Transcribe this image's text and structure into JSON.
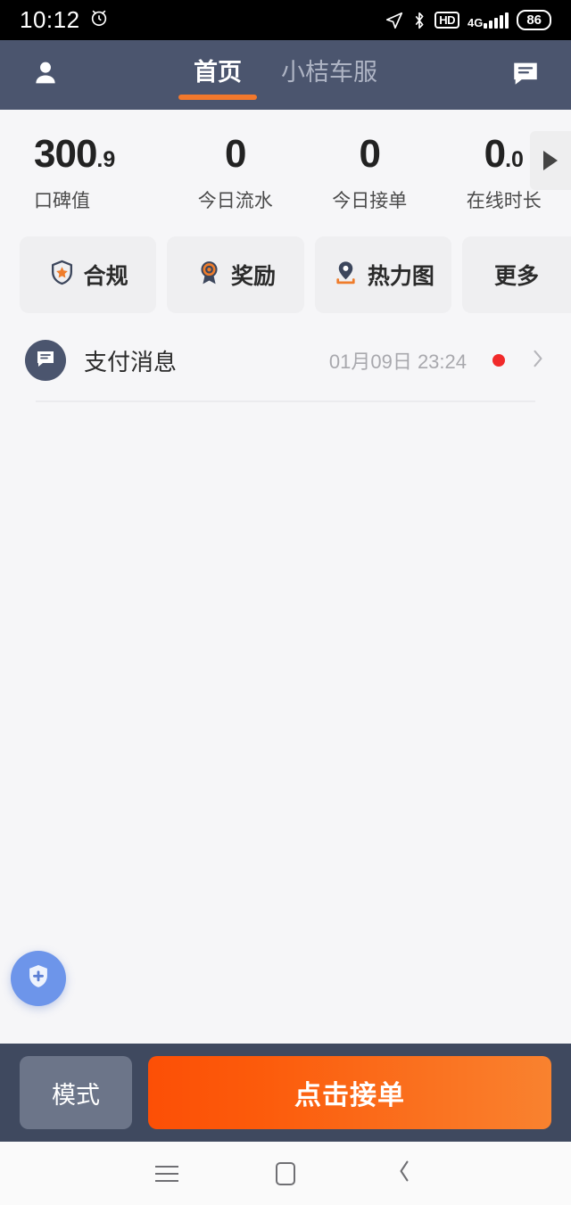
{
  "status_bar": {
    "time": "10:12",
    "alarm_icon": "alarm-icon",
    "location_icon": "location-arrow-icon",
    "bluetooth_icon": "bluetooth-icon",
    "hd_label": "HD",
    "network_label": "4G",
    "battery_level": "86"
  },
  "header": {
    "profile_icon": "person-icon",
    "message_icon": "chat-bubble-icon",
    "tabs": [
      {
        "label": "首页",
        "active": true
      },
      {
        "label": "小桔车服",
        "active": false
      }
    ],
    "background_color": "#4b556e",
    "active_underline_color": "#f2782c"
  },
  "stats": {
    "items": [
      {
        "integer": "300",
        "decimal": ".9",
        "label": "口碑值"
      },
      {
        "integer": "0",
        "decimal": "",
        "label": "今日流水"
      },
      {
        "integer": "0",
        "decimal": "",
        "label": "今日接单"
      },
      {
        "integer": "0",
        "decimal": ".0",
        "label": "在线时长"
      }
    ],
    "expand_icon": "play-triangle-right-icon"
  },
  "quick_actions": [
    {
      "label": "合规",
      "icon": "shield-star-icon"
    },
    {
      "label": "奖励",
      "icon": "medal-icon"
    },
    {
      "label": "热力图",
      "icon": "map-pin-icon"
    },
    {
      "label": "更多",
      "icon": ""
    }
  ],
  "message": {
    "avatar_icon": "chat-bubble-icon",
    "title": "支付消息",
    "timestamp": "01月09日 23:24",
    "unread_dot_color": "#f12a2a",
    "chevron_icon": "chevron-right-icon"
  },
  "floating_button": {
    "icon": "shield-plus-icon",
    "color": "#6d95ea"
  },
  "bottom_bar": {
    "mode_label": "模式",
    "accept_label": "点击接单",
    "accept_color": "#fc4f06",
    "background_color": "#3f495f"
  },
  "android_nav": {
    "recents_icon": "menu-lines-icon",
    "home_icon": "square-icon",
    "back_icon": "chevron-left-icon"
  }
}
